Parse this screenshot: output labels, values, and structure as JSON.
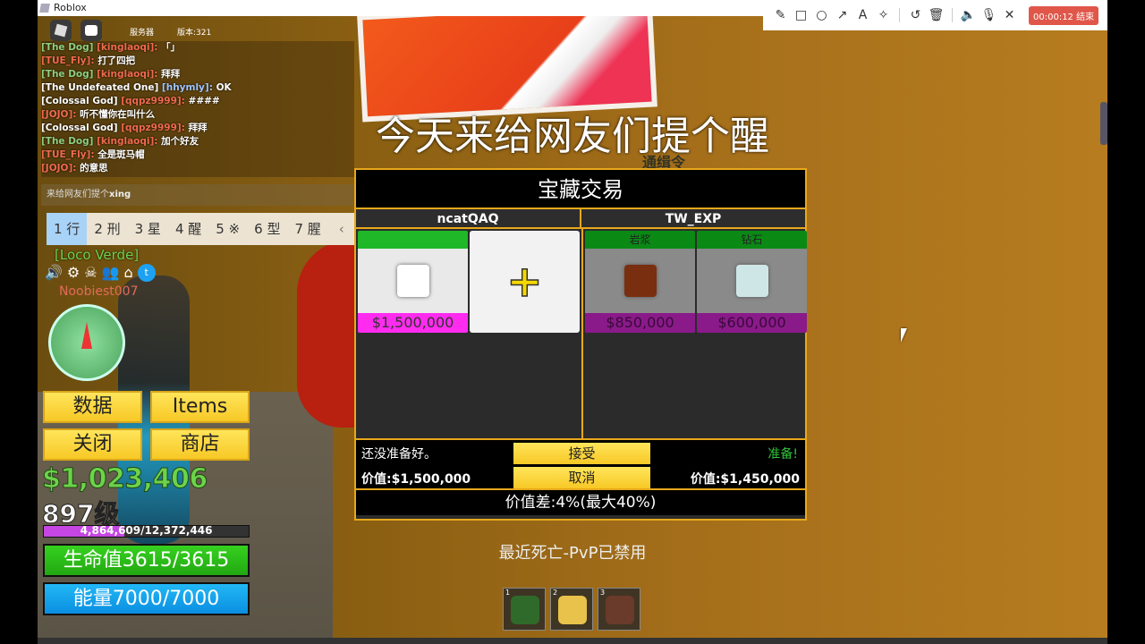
{
  "window": {
    "title": "Roblox"
  },
  "recorder": {
    "tools": [
      "pencil-icon",
      "rectangle-icon",
      "circle-icon",
      "arrow-icon",
      "text-icon",
      "magic-wand-icon",
      "undo-icon",
      "trash-icon",
      "speaker-icon",
      "microphone-icon",
      "close-icon"
    ],
    "timer": "00:00:12 结束"
  },
  "topbar": {
    "server": "服务器",
    "version": "版本:321"
  },
  "chat": {
    "messages": [
      {
        "tag": "[The Dog]",
        "tag_color": "gn",
        "name": "[kinglaoqi]:",
        "text": "「」"
      },
      {
        "tag": "",
        "name": "[TUE_Fly]:",
        "text": "打了四把"
      },
      {
        "tag": "[The Dog]",
        "tag_color": "gn",
        "name": "[kinglaoqi]:",
        "text": "拜拜"
      },
      {
        "tag": "[The Undefeated One]",
        "tag_color": "wn",
        "name": "[hhymly]:",
        "name_color": "bn",
        "text": "OK"
      },
      {
        "tag": "[Colossal God]",
        "tag_color": "wn",
        "name": "[qqpz9999]:",
        "text": "####"
      },
      {
        "tag": "",
        "name": "[JOJO]:",
        "text": "听不懂你在叫什么"
      },
      {
        "tag": "[Colossal God]",
        "tag_color": "wn",
        "name": "[qqpz9999]:",
        "text": "拜拜"
      },
      {
        "tag": "[The Dog]",
        "tag_color": "gn",
        "name": "[kinglaoqi]:",
        "text": "加个好友"
      },
      {
        "tag": "",
        "name": "[TUE_Fly]:",
        "text": "全是斑马帽"
      },
      {
        "tag": "",
        "name": "[JOJO]:",
        "text": "的意思"
      }
    ],
    "input_committed": "来给网友们提个",
    "input_composing": "xing"
  },
  "ime": {
    "candidates": [
      "1 行",
      "2 刑",
      "3 星",
      "4 醒",
      "5 ※",
      "6 型",
      "7 腥"
    ],
    "selected": 0,
    "prev": "‹",
    "next": "›",
    "emoji": "☺"
  },
  "player": {
    "crew": "[Loco Verde]",
    "name": "Noobiest007",
    "money": "$1,023,406",
    "level": "897级",
    "xp_text": "4,864,609/12,372,446",
    "xp_fraction": 0.393,
    "hp": "生命值3615/3615",
    "energy": "能量7000/7000"
  },
  "menu": {
    "stats": "数据",
    "items": "Items",
    "close": "关闭",
    "shop": "商店"
  },
  "headline": "今天来给网友们提个醒",
  "wanted_sign": "通缉令",
  "trade": {
    "title": "宝藏交易",
    "left_player": "ncatQAQ",
    "right_player": "TW_EXP",
    "left_items": [
      {
        "name": "",
        "price": "$1,500,000",
        "color": "#ffffff"
      }
    ],
    "add_icon": "+",
    "right_items": [
      {
        "name": "岩浆",
        "price": "$850,000",
        "color": "#7a2e10"
      },
      {
        "name": "钻石",
        "price": "$600,000",
        "color": "#cfe6e6"
      }
    ],
    "left_status": "还没准备好。",
    "right_status": "准备!",
    "left_value": "价值:$1,500,000",
    "right_value": "价值:$1,450,000",
    "accept": "接受",
    "cancel": "取消",
    "diff": "价值差:4%(最大40%)"
  },
  "pvp_notice": "最近死亡-PvP已禁用",
  "hotbar": [
    {
      "key": "1",
      "color": "#2f6a2a"
    },
    {
      "key": "2",
      "color": "#e8c24a"
    },
    {
      "key": "3",
      "color": "#6a3a2a"
    }
  ]
}
